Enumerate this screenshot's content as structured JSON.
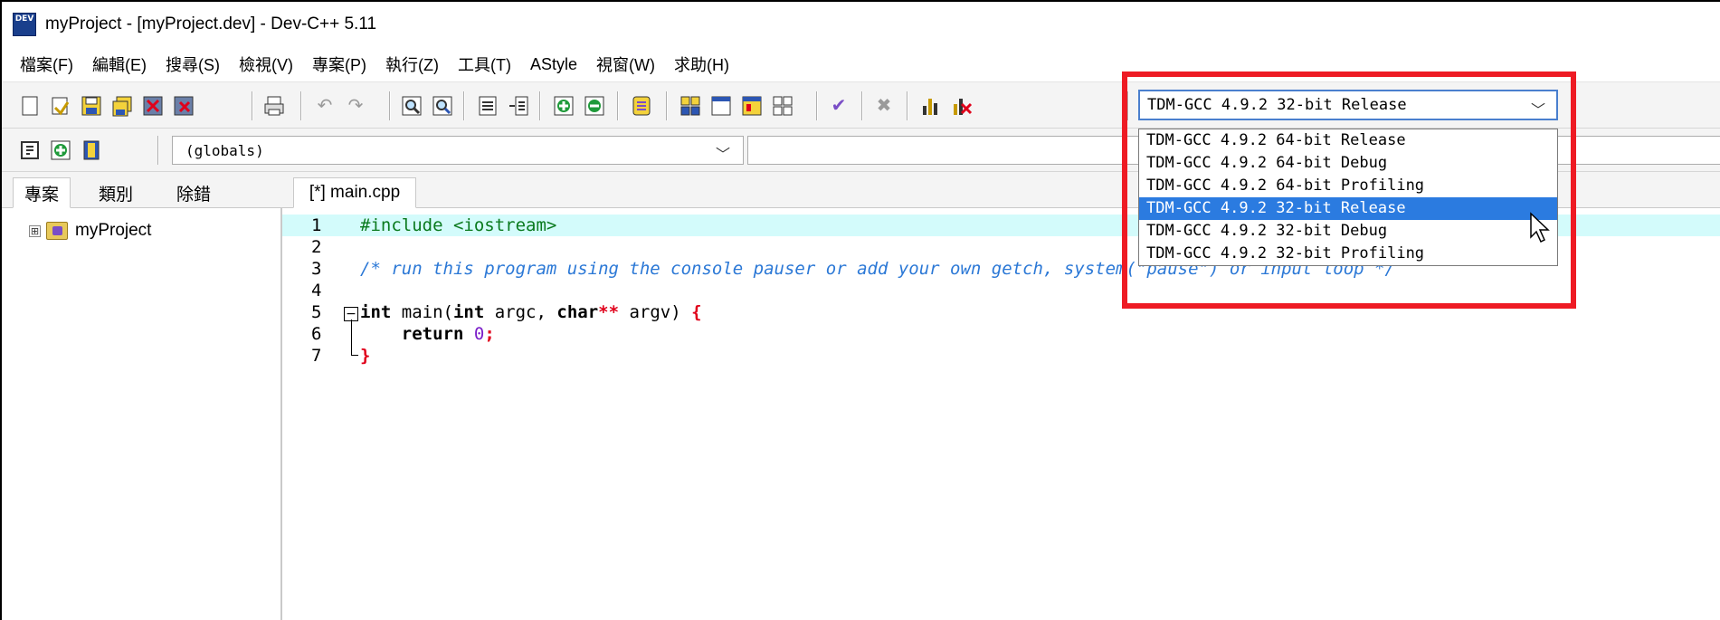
{
  "window": {
    "title": "myProject - [myProject.dev] - Dev-C++ 5.11",
    "app_icon_label": "DEV"
  },
  "menubar": {
    "items": [
      "檔案(F)",
      "編輯(E)",
      "搜尋(S)",
      "檢視(V)",
      "專案(P)",
      "執行(Z)",
      "工具(T)",
      "AStyle",
      "視窗(W)",
      "求助(H)"
    ]
  },
  "toolbar": {
    "compiler_selected": "TDM-GCC 4.9.2 32-bit Release",
    "globals_selected": "(globals)"
  },
  "compiler_dropdown": {
    "options": [
      "TDM-GCC 4.9.2 64-bit Release",
      "TDM-GCC 4.9.2 64-bit Debug",
      "TDM-GCC 4.9.2 64-bit Profiling",
      "TDM-GCC 4.9.2 32-bit Release",
      "TDM-GCC 4.9.2 32-bit Debug",
      "TDM-GCC 4.9.2 32-bit Profiling"
    ],
    "selected": "TDM-GCC 4.9.2 32-bit Release"
  },
  "left_panel": {
    "tabs": [
      "專案",
      "類別",
      "除錯"
    ],
    "tree": {
      "project_name": "myProject",
      "expander": "⊞"
    }
  },
  "editor": {
    "tab_label": "[*] main.cpp",
    "line_numbers": [
      "1",
      "2",
      "3",
      "4",
      "5",
      "6",
      "7"
    ],
    "code": {
      "l1_pp": "#include <iostream>",
      "l3_comment": "/* run this program using the console pauser or add your own getch, system(\"pause\") or input loop */",
      "l5_kw1": "int",
      "l5_t1": " main(",
      "l5_kw2": "int",
      "l5_t2": " argc, ",
      "l5_kw3": "char",
      "l5_red1": "**",
      "l5_t3": " argv) ",
      "l5_red2": "{",
      "l6_kw": "return",
      "l6_num": "0",
      "l6_red": ";",
      "l7_red": "}"
    }
  },
  "colors": {
    "highlight_box": "#ee1b24",
    "dropdown_selected": "#2b7be0",
    "current_line": "#d3fbfb"
  }
}
